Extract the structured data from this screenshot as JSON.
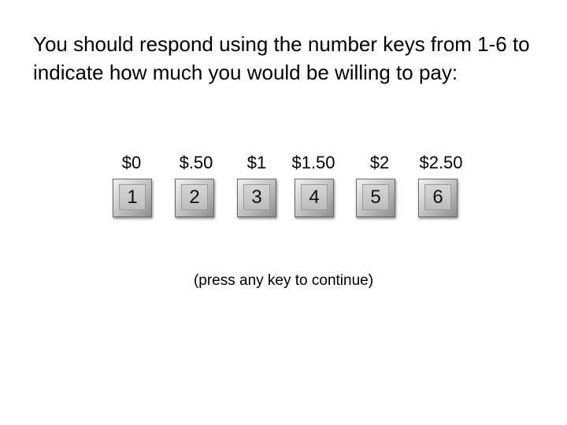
{
  "instructions": {
    "text": "You should respond using the number keys from 1-6 to indicate how much you would be willing to pay:"
  },
  "options": [
    {
      "price": "$0",
      "key": "1"
    },
    {
      "price": "$.50",
      "key": "2"
    },
    {
      "price": "$1",
      "key": "3"
    },
    {
      "price": "$1.50",
      "key": "4"
    },
    {
      "price": "$2",
      "key": "5"
    },
    {
      "price": "$2.50",
      "key": "6"
    }
  ],
  "continue_prompt": "(press any key to continue)"
}
